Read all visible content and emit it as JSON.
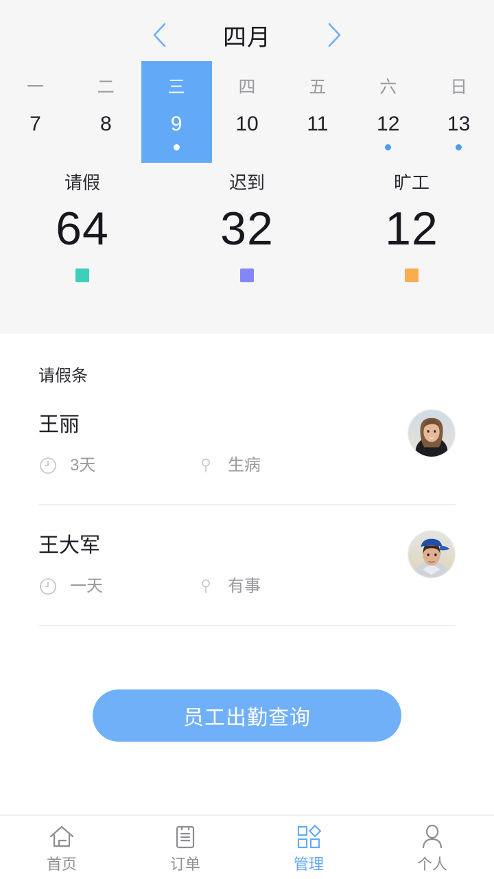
{
  "theme": {
    "accent": "#62aaf8",
    "accent_button": "#6fb0f8",
    "panel_bg": "#f6f6f7",
    "page_bg": "#ffffff",
    "muted_text": "#9a9aa0"
  },
  "calendar": {
    "prev_icon": "chevron-left-icon",
    "next_icon": "chevron-right-icon",
    "month": "四月",
    "days": [
      {
        "dow": "一",
        "num": "7",
        "selected": false,
        "dot": false
      },
      {
        "dow": "二",
        "num": "8",
        "selected": false,
        "dot": false
      },
      {
        "dow": "三",
        "num": "9",
        "selected": true,
        "dot": true
      },
      {
        "dow": "四",
        "num": "10",
        "selected": false,
        "dot": false
      },
      {
        "dow": "五",
        "num": "11",
        "selected": false,
        "dot": false
      },
      {
        "dow": "六",
        "num": "12",
        "selected": false,
        "dot": true
      },
      {
        "dow": "日",
        "num": "13",
        "selected": false,
        "dot": true
      }
    ]
  },
  "stats": [
    {
      "label": "请假",
      "value": "64",
      "color": "#3ecfbb"
    },
    {
      "label": "迟到",
      "value": "32",
      "color": "#8286f7"
    },
    {
      "label": "旷工",
      "value": "12",
      "color": "#f9ad4e"
    }
  ],
  "list": {
    "title": "请假条",
    "rows": [
      {
        "name": "王丽",
        "duration_icon": "clock-icon",
        "duration": "3天",
        "reason_icon": "pin-icon",
        "reason": "生病",
        "avatar": "avatar-woman"
      },
      {
        "name": "王大军",
        "duration_icon": "clock-icon",
        "duration": "一天",
        "reason_icon": "pin-icon",
        "reason": "有事",
        "avatar": "avatar-man-cap"
      }
    ]
  },
  "cta": {
    "label": "员工出勤查询"
  },
  "tabbar": {
    "items": [
      {
        "label": "首页",
        "icon": "home-icon",
        "active": false
      },
      {
        "label": "订单",
        "icon": "clipboard-icon",
        "active": false
      },
      {
        "label": "管理",
        "icon": "grid-manage-icon",
        "active": true
      },
      {
        "label": "个人",
        "icon": "person-icon",
        "active": false
      }
    ]
  }
}
